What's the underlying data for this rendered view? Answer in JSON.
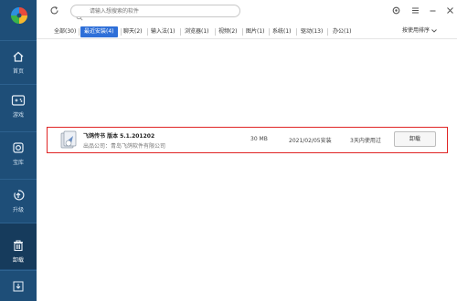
{
  "sidebar": {
    "items": [
      {
        "label": "首页",
        "icon": "home-icon"
      },
      {
        "label": "游戏",
        "icon": "gamepad-icon"
      },
      {
        "label": "宝库",
        "icon": "treasure-icon"
      },
      {
        "label": "升级",
        "icon": "upgrade-icon"
      },
      {
        "label": "卸载",
        "icon": "trash-icon"
      }
    ],
    "download_icon": "download-icon"
  },
  "topbar": {
    "search_placeholder": "请输入想搜索的软件"
  },
  "tabs": [
    {
      "label": "全部(30)"
    },
    {
      "label": "最近安装(4)"
    },
    {
      "label": "聊天(2)"
    },
    {
      "label": "输入法(1)"
    },
    {
      "label": "浏览器(1)"
    },
    {
      "label": "视频(2)"
    },
    {
      "label": "图片(1)"
    },
    {
      "label": "系统(1)"
    },
    {
      "label": "驱动(13)"
    },
    {
      "label": "办公(1)"
    }
  ],
  "sort_label": "按使用排序",
  "app": {
    "name": "飞鸽传书 版本 5.1.201202",
    "publisher": "出品公司：青岛飞鸽软件有限公司",
    "size": "30 MB",
    "install_date": "2021/02/05安装",
    "last_used": "3天内使用过",
    "uninstall_label": "卸载"
  },
  "colors": {
    "sidebar": "#1e4e78",
    "sidebar_active": "#163b5c",
    "tab_active": "#2e6fd8",
    "highlight": "#e02424"
  }
}
